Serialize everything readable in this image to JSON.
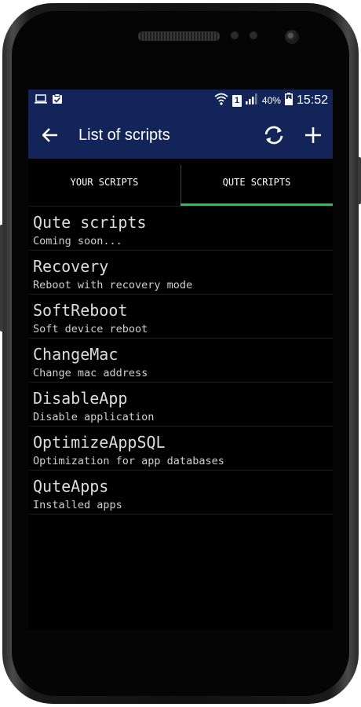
{
  "status_bar": {
    "left_icons": [
      "laptop-icon",
      "clipboard-check-icon"
    ],
    "sim_number": "1",
    "battery_percent": "40%",
    "time": "15:52"
  },
  "app_bar": {
    "title": "List of scripts",
    "back_icon": "arrow-left-icon",
    "refresh_icon": "sync-icon",
    "add_icon": "plus-icon"
  },
  "tabs": [
    {
      "label": "YOUR SCRIPTS",
      "active": false
    },
    {
      "label": "QUTE SCRIPTS",
      "active": true
    }
  ],
  "scripts": [
    {
      "title": "Qute scripts",
      "subtitle": "Coming soon..."
    },
    {
      "title": "Recovery",
      "subtitle": "Reboot with recovery mode"
    },
    {
      "title": "SoftReboot",
      "subtitle": "Soft device reboot"
    },
    {
      "title": "ChangeMac",
      "subtitle": "Change mac address"
    },
    {
      "title": "DisableApp",
      "subtitle": "Disable application"
    },
    {
      "title": "OptimizeAppSQL",
      "subtitle": "Optimization for app databases"
    },
    {
      "title": "QuteApps",
      "subtitle": "Installed apps"
    }
  ],
  "colors": {
    "app_bar": "#132459",
    "tab_indicator": "#2fbf4f",
    "background": "#000000"
  }
}
